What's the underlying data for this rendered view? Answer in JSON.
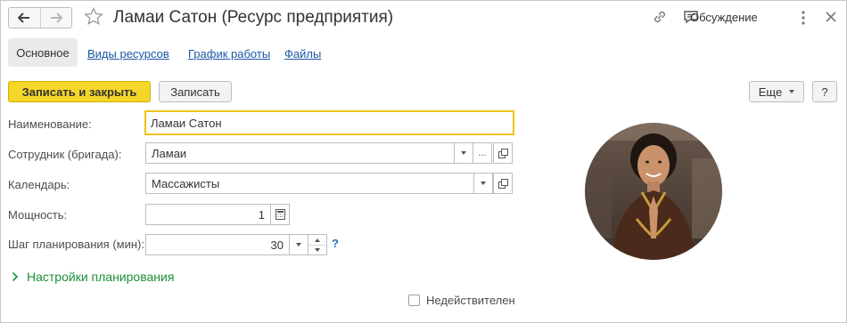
{
  "window": {
    "title": "Ламаи Сатон (Ресурс предприятия)",
    "discussion_label": "Обсуждение"
  },
  "tabs": [
    {
      "label": "Основное",
      "active": true
    },
    {
      "label": "Виды ресурсов",
      "active": false
    },
    {
      "label": "График работы",
      "active": false
    },
    {
      "label": "Файлы",
      "active": false
    }
  ],
  "toolbar": {
    "save_close_label": "Записать и закрыть",
    "save_label": "Записать",
    "more_label": "Еще",
    "help_label": "?"
  },
  "form": {
    "name": {
      "label": "Наименование:",
      "value": "Ламаи Сатон"
    },
    "employee": {
      "label": "Сотрудник (бригада):",
      "value": "Ламаи",
      "ellipsis": "..."
    },
    "calendar": {
      "label": "Календарь:",
      "value": "Массажисты"
    },
    "capacity": {
      "label": "Мощность:",
      "value": "1"
    },
    "step": {
      "label": "Шаг планирования (мин):",
      "value": "30",
      "help": "?"
    },
    "planning_settings": "Настройки планирования",
    "inactive": {
      "label": "Недействителен",
      "checked": false
    }
  },
  "colors": {
    "accent": "#f5d72a",
    "link": "#1a57a6",
    "green": "#1b8f3a"
  }
}
